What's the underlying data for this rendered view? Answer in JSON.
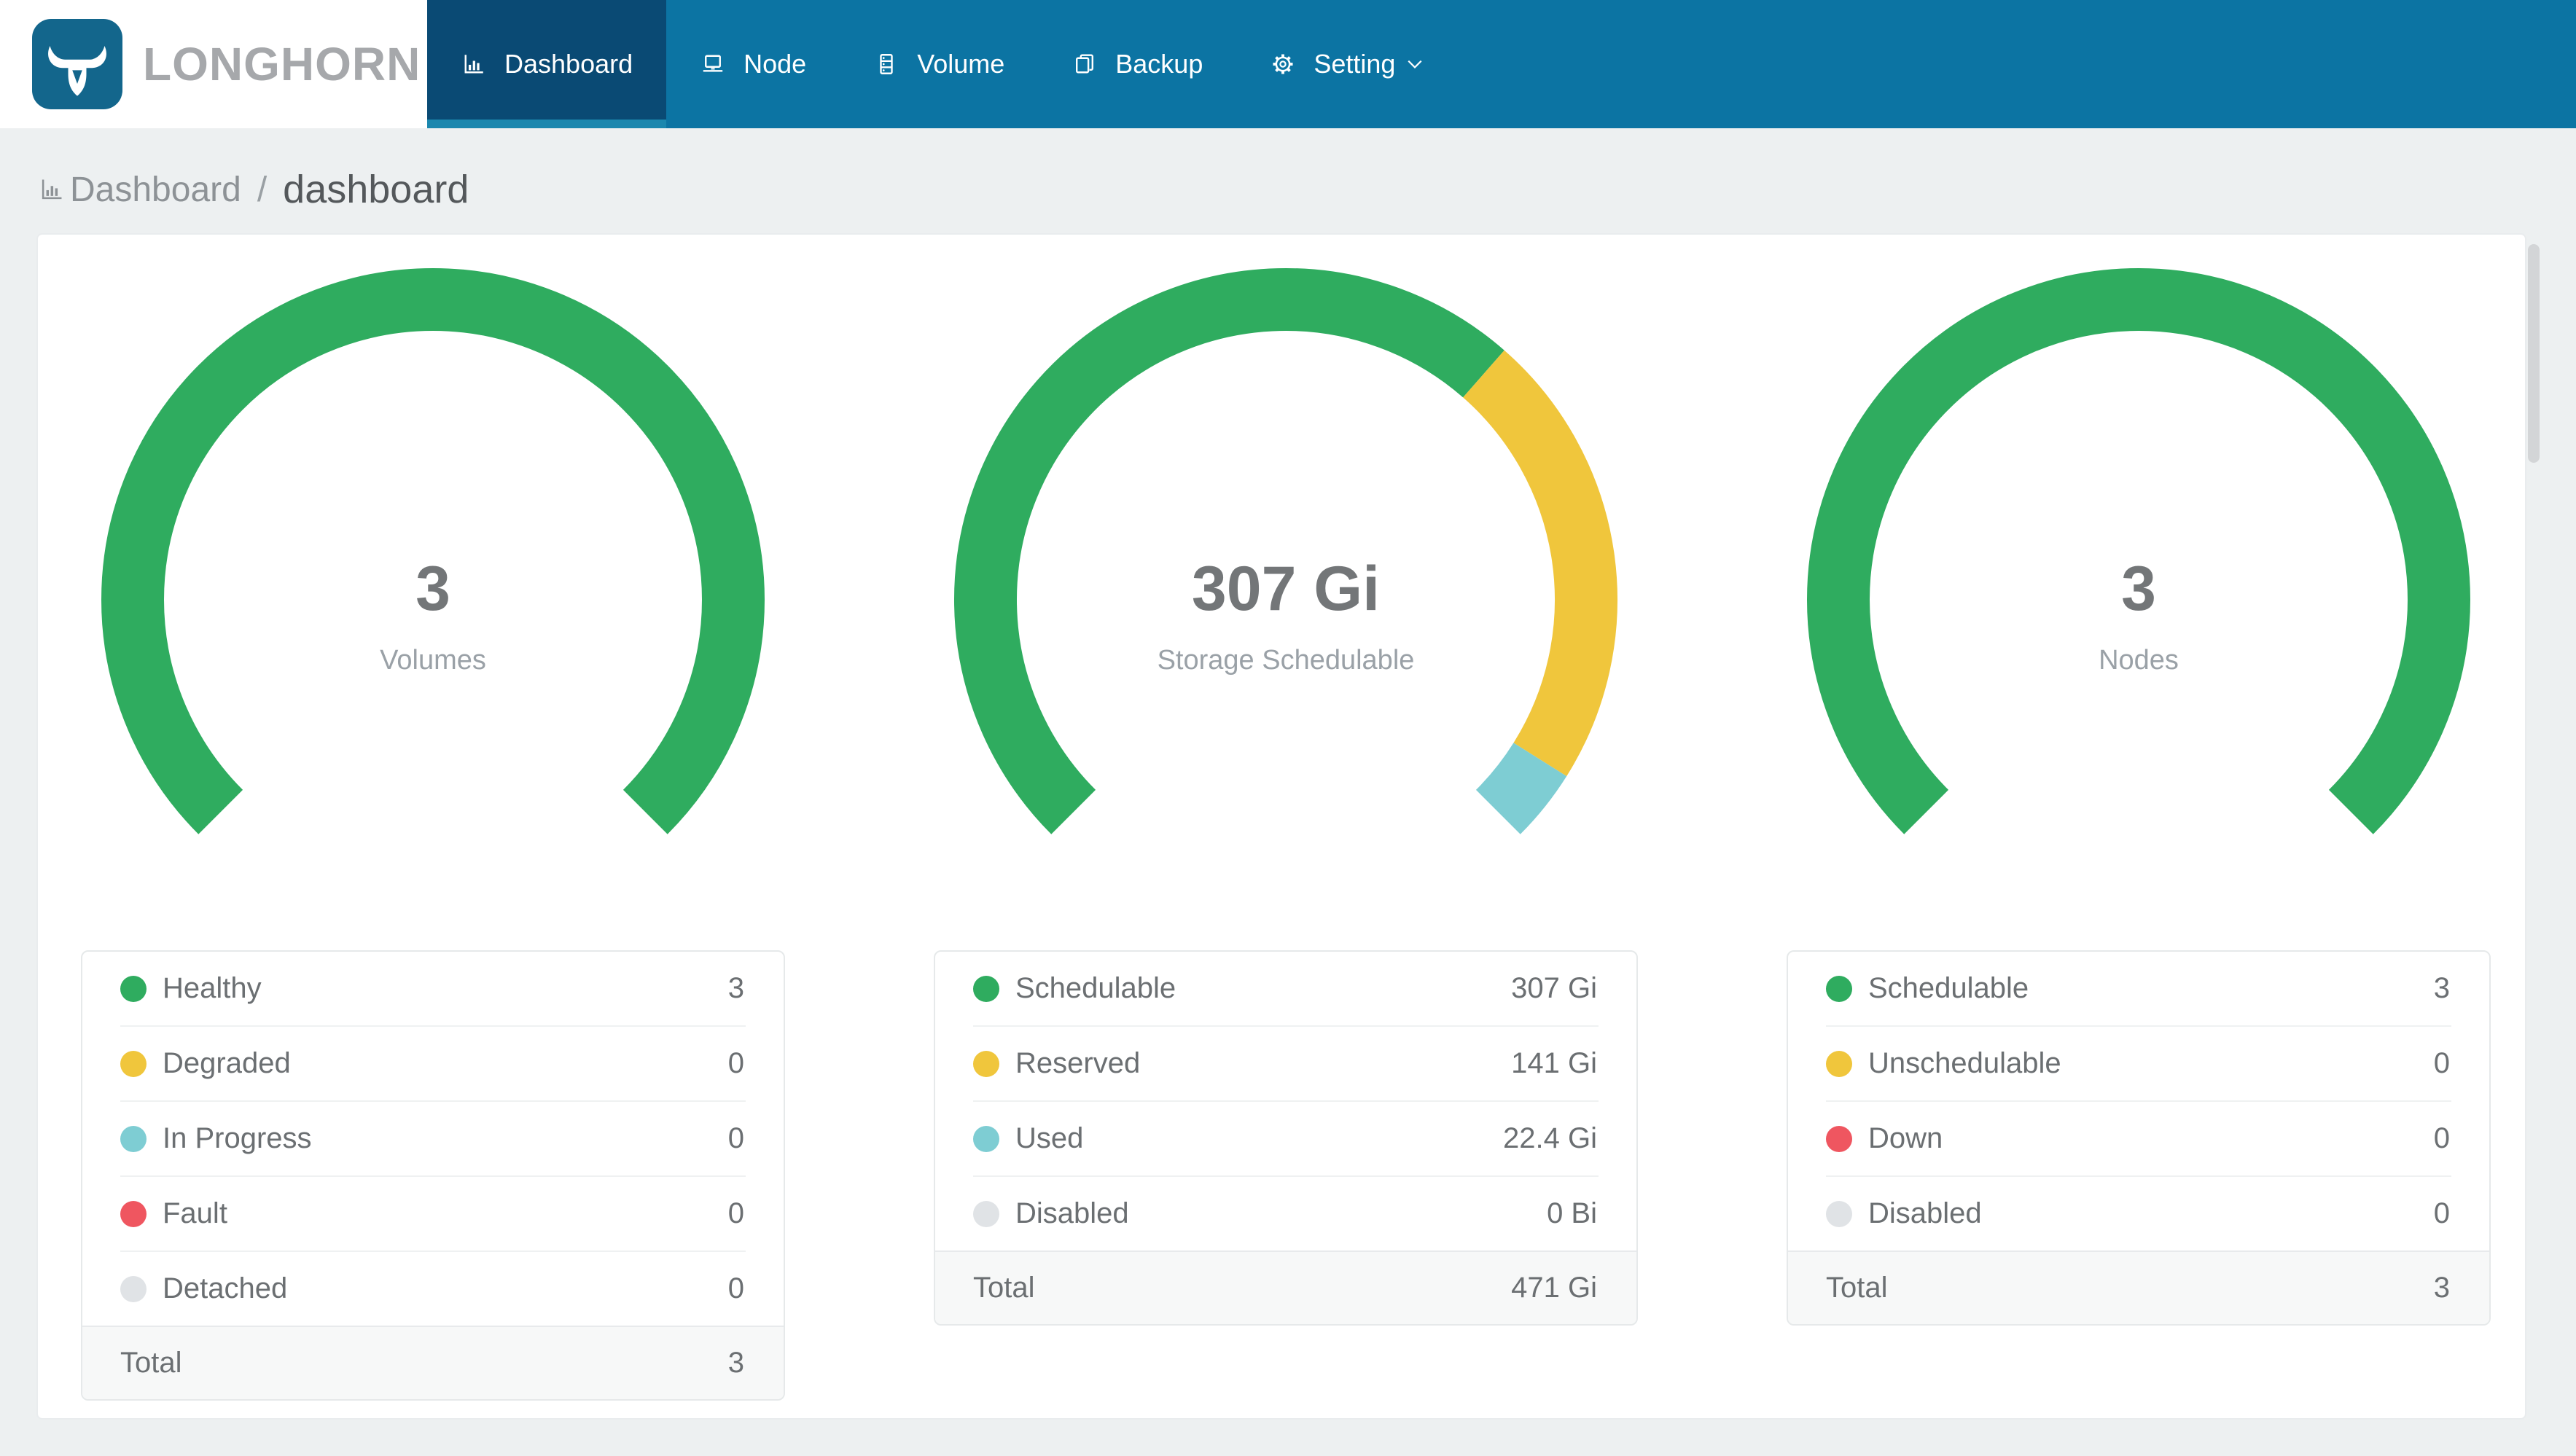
{
  "header": {
    "brand": {
      "text": "LONGHORN",
      "icon": "longhorn-bull-icon"
    },
    "nav_items": [
      {
        "label": "Dashboard",
        "icon": "bar-chart-icon",
        "active": true,
        "has_dropdown": false
      },
      {
        "label": "Node",
        "icon": "laptop-icon",
        "active": false,
        "has_dropdown": false
      },
      {
        "label": "Volume",
        "icon": "server-icon",
        "active": false,
        "has_dropdown": false
      },
      {
        "label": "Backup",
        "icon": "copy-file-icon",
        "active": false,
        "has_dropdown": false
      },
      {
        "label": "Setting",
        "icon": "gear-icon",
        "active": false,
        "has_dropdown": true
      }
    ]
  },
  "breadcrumb": {
    "icon": "bar-chart-icon",
    "root": "Dashboard",
    "separator": "/",
    "current": "dashboard"
  },
  "colors": {
    "page": "#edf0f1",
    "navbar": "#0c74a3",
    "navbar_active": "#0a4a74",
    "navbar_underline": "#1b87ae",
    "brand_blue": "#13668c",
    "palette": {
      "green": "#2fac5f",
      "yellow": "#f0c63c",
      "teal": "#7ecdd3",
      "red": "#ef5660",
      "gray": "#e0e3e6"
    }
  },
  "chart_data": [
    {
      "type": "donut-gauge",
      "center_value": "3",
      "center_label": "Volumes",
      "arc": {
        "start_deg": 135,
        "sweep_deg": 270,
        "outer_radius": 455,
        "stroke_width": 86
      },
      "segments": [
        {
          "label": "Healthy",
          "color_key": "green",
          "value": 3,
          "display": "3"
        },
        {
          "label": "Degraded",
          "color_key": "yellow",
          "value": 0,
          "display": "0"
        },
        {
          "label": "In Progress",
          "color_key": "teal",
          "value": 0,
          "display": "0"
        },
        {
          "label": "Fault",
          "color_key": "red",
          "value": 0,
          "display": "0"
        },
        {
          "label": "Detached",
          "color_key": "gray",
          "value": 0,
          "display": "0"
        }
      ],
      "total": {
        "label": "Total",
        "value": 3,
        "display": "3"
      }
    },
    {
      "type": "donut-gauge",
      "center_value": "307 Gi",
      "center_label": "Storage Schedulable",
      "arc": {
        "start_deg": 135,
        "sweep_deg": 270,
        "outer_radius": 455,
        "stroke_width": 86
      },
      "segments": [
        {
          "label": "Schedulable",
          "color_key": "green",
          "value": 307,
          "display": "307 Gi"
        },
        {
          "label": "Reserved",
          "color_key": "yellow",
          "value": 141,
          "display": "141 Gi"
        },
        {
          "label": "Used",
          "color_key": "teal",
          "value": 22.4,
          "display": "22.4 Gi"
        },
        {
          "label": "Disabled",
          "color_key": "gray",
          "value": 0,
          "display": "0 Bi"
        }
      ],
      "total": {
        "label": "Total",
        "value": 471,
        "display": "471 Gi"
      }
    },
    {
      "type": "donut-gauge",
      "center_value": "3",
      "center_label": "Nodes",
      "arc": {
        "start_deg": 135,
        "sweep_deg": 270,
        "outer_radius": 455,
        "stroke_width": 86
      },
      "segments": [
        {
          "label": "Schedulable",
          "color_key": "green",
          "value": 3,
          "display": "3"
        },
        {
          "label": "Unschedulable",
          "color_key": "yellow",
          "value": 0,
          "display": "0"
        },
        {
          "label": "Down",
          "color_key": "red",
          "value": 0,
          "display": "0"
        },
        {
          "label": "Disabled",
          "color_key": "gray",
          "value": 0,
          "display": "0"
        }
      ],
      "total": {
        "label": "Total",
        "value": 3,
        "display": "3"
      }
    }
  ]
}
